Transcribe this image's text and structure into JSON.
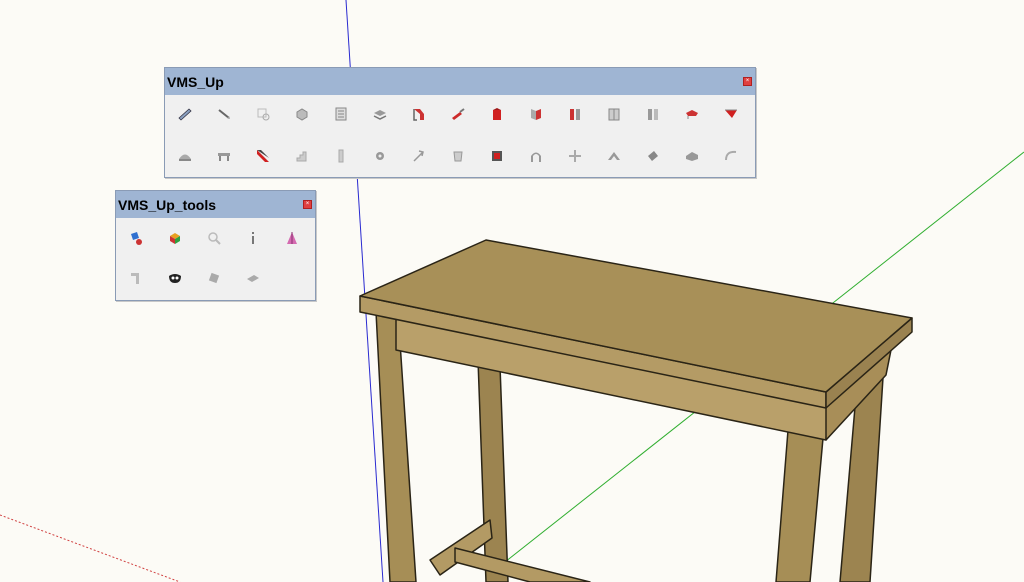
{
  "scene": {
    "axis_colors": {
      "red": "#d04040",
      "green": "#2fae2f",
      "blue": "#2a2ad0"
    },
    "table_color": "#a89058"
  },
  "toolbars": [
    {
      "id": "vms-up",
      "title": "VMS_Up",
      "buttons": [
        [
          "ruler-icon",
          "line-tool-icon",
          "select-icon",
          "box-icon",
          "list-icon",
          "layers-icon",
          "door-frame-icon",
          "brush-icon",
          "red-door-icon",
          "wall-corner-icon",
          "double-door-icon",
          "window-icon",
          "window-split-icon",
          "roof-icon",
          "red-roof-icon"
        ],
        [
          "dome-icon",
          "desk-icon",
          "red-door-frame-icon",
          "stair-icon",
          "column-icon",
          "gear-icon",
          "axis-icon",
          "lamp-icon",
          "red-window-icon",
          "arch-icon",
          "cross-icon",
          "gable-icon",
          "tilted-box-icon",
          "wedge-icon",
          "curve-icon"
        ]
      ]
    },
    {
      "id": "vms-up-tools",
      "title": "VMS_Up_tools",
      "buttons": [
        [
          "paint-tool-icon",
          "cube-color-icon",
          "zoom-icon",
          "info-icon",
          "prism-icon"
        ],
        [
          "corner-piece-icon",
          "mask-icon",
          "move-tool-icon",
          "flat-panel-icon"
        ]
      ]
    }
  ]
}
